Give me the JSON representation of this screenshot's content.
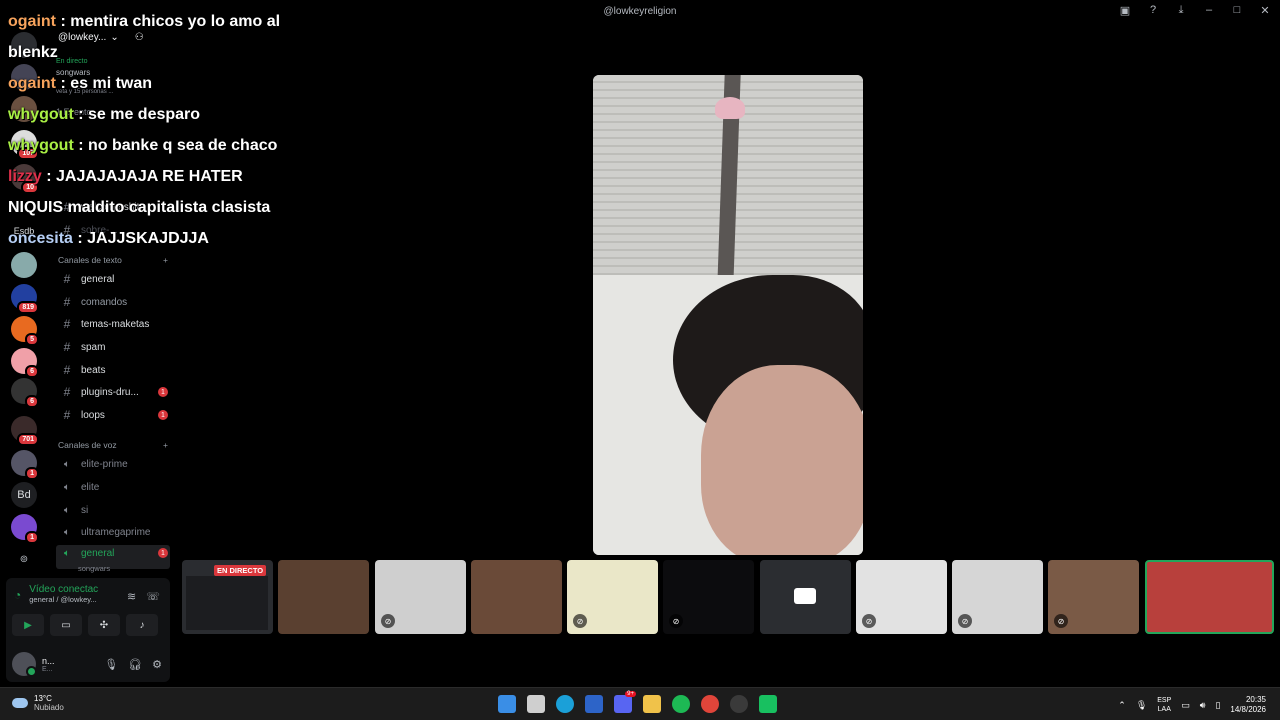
{
  "window": {
    "title": "@lowkeyreligion"
  },
  "chat": [
    {
      "user": "ogaint",
      "text": " : mentira chicos yo lo amo al",
      "color": "#f7a35c"
    },
    {
      "user": "",
      "text": "blenkz",
      "color": "#ffffff"
    },
    {
      "user": "ogaint",
      "text": " : es mi twan",
      "color": "#f7a35c"
    },
    {
      "user": "whygout",
      "text": " : se me desparo",
      "color": "#a9f045"
    },
    {
      "user": "whygout",
      "text": " : no banke q sea de chaco",
      "color": "#a9f045"
    },
    {
      "user": "lizzy",
      "text": " : JAJAJAJAJA RE HATER",
      "color": "#e0304a"
    },
    {
      "user": "",
      "text": "NIQUIS maldito capitalista clasista",
      "color": "#ffffff"
    },
    {
      "user": "oncesita",
      "text": " : JAJJSKAJDJJA",
      "color": "#b6cff5"
    }
  ],
  "server": {
    "name": "@lowkey...",
    "live_label": "En directo",
    "live_name": "songwars",
    "live_viewers": "veta y 15 personas ...",
    "event": "1 Evento"
  },
  "rail": {
    "badges": [
      "107",
      "10",
      "819",
      "5",
      "6",
      "6",
      "701",
      "1",
      "1"
    ],
    "labels": [
      "Esdb",
      "Bd"
    ]
  },
  "channels": {
    "top": [
      "welcome-shit",
      "sobre-..."
    ],
    "text_header": "Canales de texto",
    "text": [
      {
        "name": "general",
        "unread": ""
      },
      {
        "name": "comandos",
        "unread": ""
      },
      {
        "name": "temas-maketas",
        "unread": ""
      },
      {
        "name": "spam",
        "unread": ""
      },
      {
        "name": "beats",
        "unread": ""
      },
      {
        "name": "plugins-dru...",
        "unread": "1"
      },
      {
        "name": "loops",
        "unread": "1"
      }
    ],
    "voice_header": "Canales de voz",
    "voice": [
      {
        "name": "elite-prime"
      },
      {
        "name": "elite"
      },
      {
        "name": "si"
      },
      {
        "name": "ultramegaprime"
      }
    ],
    "active_voice": {
      "name": "general",
      "sub": "songwars",
      "unread": "1"
    }
  },
  "voice_panel": {
    "status": "Vídeo conectac",
    "location": "general / @lowkey...",
    "user": "n...",
    "user_status": "E..."
  },
  "tiles": {
    "live_label": "EN DIRECTO"
  },
  "taskbar": {
    "temp": "13°C",
    "weather": "Nubiado",
    "lang1": "ESP",
    "lang2": "LAA",
    "time": "20:35",
    "date": "14/8/2026",
    "discord_badge": "9+"
  }
}
